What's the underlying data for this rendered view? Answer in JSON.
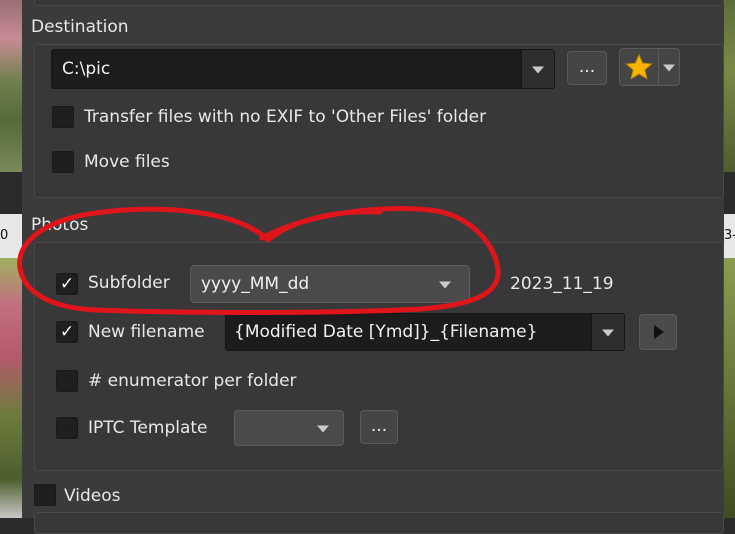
{
  "edge": {
    "left_text": "0",
    "right_text": "3-"
  },
  "destination": {
    "heading": "Destination",
    "path_value": "C:\\pic",
    "browse_label": "...",
    "favorite_icon": "star-icon",
    "options": [
      {
        "label": "Transfer files with no EXIF to 'Other Files' folder",
        "checked": false
      },
      {
        "label": "Move files",
        "checked": false
      }
    ]
  },
  "photos": {
    "heading": "Photos",
    "subfolder": {
      "label": "Subfolder",
      "checked": true,
      "pattern": "yyyy_MM_dd",
      "preview": "2023_11_19"
    },
    "new_filename": {
      "label": "New filename",
      "checked": true,
      "pattern": "{Modified Date [Ymd]}_{Filename}"
    },
    "enumerator": {
      "label": "# enumerator per folder",
      "checked": false
    },
    "iptc": {
      "label": "IPTC Template",
      "checked": false,
      "value": "",
      "browse_label": "..."
    }
  },
  "videos": {
    "label": "Videos",
    "checked": false
  },
  "annotation": {
    "color": "#e0151b"
  },
  "check_mark": "✓"
}
